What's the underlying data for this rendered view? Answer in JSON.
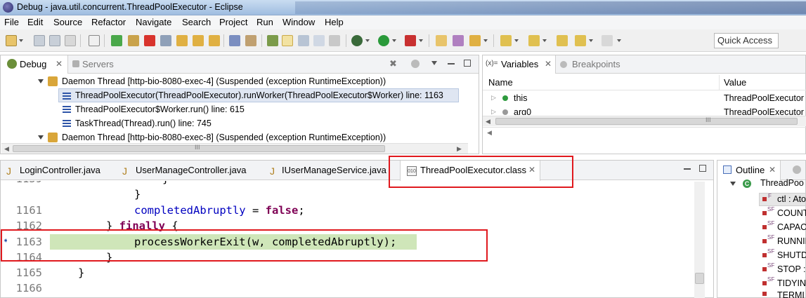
{
  "window": {
    "title": "Debug - java.util.concurrent.ThreadPoolExecutor - Eclipse"
  },
  "menu": [
    "File",
    "Edit",
    "Source",
    "Refactor",
    "Navigate",
    "Search",
    "Project",
    "Run",
    "Window",
    "Help"
  ],
  "toolbar": {
    "quick_access": "Quick Access"
  },
  "debug_view": {
    "tab_debug": "Debug",
    "tab_servers": "Servers",
    "rows": [
      "Daemon Thread [http-bio-8080-exec-4] (Suspended (exception RuntimeException))",
      "ThreadPoolExecutor(ThreadPoolExecutor).runWorker(ThreadPoolExecutor$Worker) line: 1163",
      "ThreadPoolExecutor$Worker.run() line: 615",
      "TaskThread(Thread).run() line: 745",
      "Daemon Thread [http-bio-8080-exec-8] (Suspended (exception RuntimeException))"
    ],
    "scroll_marker": "III"
  },
  "variables_view": {
    "tab_variables": "Variables",
    "tab_breakpoints": "Breakpoints",
    "prefix": "(x)=",
    "col_name": "Name",
    "col_value": "Value",
    "rows": [
      {
        "name": "this",
        "value": "ThreadPoolExecutor"
      },
      {
        "name": "arg0",
        "value": "ThreadPoolExecutor"
      }
    ],
    "scroll_marker": "III"
  },
  "editor": {
    "tabs": [
      "LoginController.java",
      "UserManageController.java",
      "IUserManageService.java",
      "ThreadPoolExecutor.class"
    ],
    "active_tab": "ThreadPoolExecutor.class",
    "lines": [
      {
        "num": "1159",
        "text": "}"
      },
      {
        "num": "",
        "text": "}"
      },
      {
        "num": "1161",
        "text": "completedAbruptly = false;"
      },
      {
        "num": "1162",
        "text": "} finally {"
      },
      {
        "num": "1163",
        "text": "processWorkerExit(w, completedAbruptly);"
      },
      {
        "num": "1164",
        "text": "}"
      },
      {
        "num": "1165",
        "text": "}"
      },
      {
        "num": "1166",
        "text": ""
      }
    ],
    "current_line": "1163"
  },
  "outline_view": {
    "tab_outline": "Outline",
    "class_name": "ThreadPoo",
    "items": [
      "ctl : Ato",
      "COUNT",
      "CAPACI",
      "RUNNIN",
      "SHUTD",
      "STOP :",
      "TIDYIN",
      "TERMI"
    ],
    "badge": "SF",
    "first_badge": "F"
  },
  "colors": {
    "highlight_line": "#cfe6b9",
    "annotation_red": "#e0191e",
    "keyword": "#7f0055",
    "field": "#0000c0"
  }
}
